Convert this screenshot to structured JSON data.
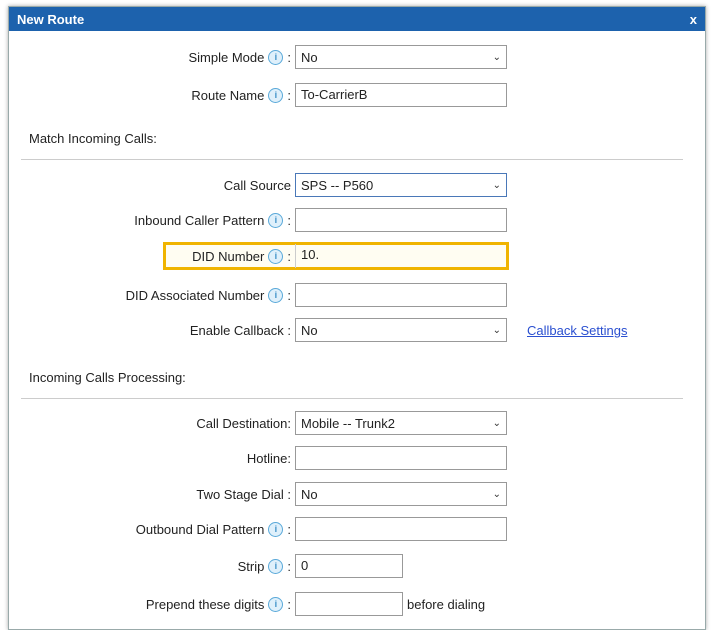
{
  "dialog": {
    "title": "New Route",
    "close": "x"
  },
  "simple_mode": {
    "label": "Simple Mode",
    "value": "No"
  },
  "route_name": {
    "label": "Route Name",
    "value": "To-CarrierB"
  },
  "section1": "Match Incoming Calls:",
  "call_source": {
    "label": "Call Source",
    "value": "SPS -- P560"
  },
  "inbound_caller_pattern": {
    "label": "Inbound Caller Pattern",
    "value": ""
  },
  "did_number": {
    "label": "DID Number",
    "value": "10."
  },
  "did_associated": {
    "label": "DID Associated Number",
    "value": ""
  },
  "enable_callback": {
    "label": "Enable Callback :",
    "value": "No",
    "link": "Callback Settings"
  },
  "section2": "Incoming Calls Processing:",
  "call_destination": {
    "label": "Call Destination:",
    "value": "Mobile -- Trunk2"
  },
  "hotline": {
    "label": "Hotline:",
    "value": ""
  },
  "two_stage_dial": {
    "label": "Two Stage Dial :",
    "value": "No"
  },
  "outbound_dial_pattern": {
    "label": "Outbound Dial Pattern",
    "value": ""
  },
  "strip": {
    "label": "Strip",
    "value": "0"
  },
  "prepend": {
    "label": "Prepend these digits",
    "value": "",
    "suffix": "before dialing"
  },
  "icons": {
    "info": "i",
    "colon": ":",
    "chevron": "⌄"
  }
}
